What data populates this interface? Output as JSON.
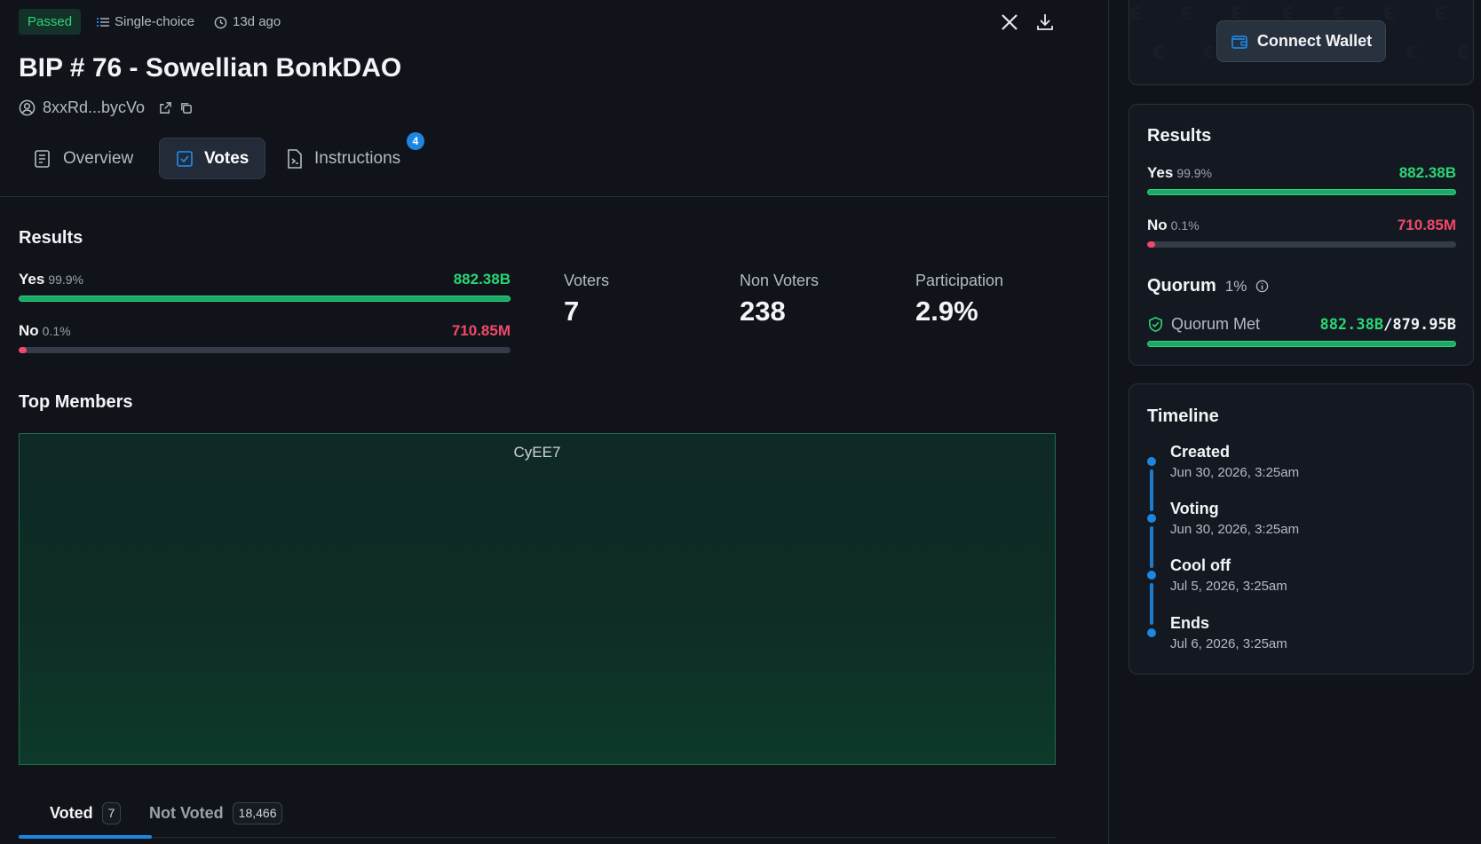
{
  "header": {
    "status": "Passed",
    "vote_type": "Single-choice",
    "time_ago": "13d ago",
    "title": "BIP # 76 - Sowellian BonkDAO",
    "author": "8xxRd...bycVo"
  },
  "tabs": [
    {
      "label": "Overview",
      "icon": "document-list-icon"
    },
    {
      "label": "Votes",
      "icon": "checkbox-icon",
      "active": true
    },
    {
      "label": "Instructions",
      "icon": "code-file-icon",
      "badge": "4"
    }
  ],
  "results": {
    "heading": "Results",
    "yes": {
      "label": "Yes",
      "pct": "99.9%",
      "value": "882.38B",
      "fill": 1.0
    },
    "no": {
      "label": "No",
      "pct": "0.1%",
      "value": "710.85M",
      "fill": 0.001
    }
  },
  "stats": {
    "voters_label": "Voters",
    "voters": "7",
    "non_voters_label": "Non Voters",
    "non_voters": "238",
    "participation_label": "Participation",
    "participation": "2.9%"
  },
  "top_members": {
    "heading": "Top Members",
    "member": "CyEE7"
  },
  "bottom_tabs": {
    "voted_label": "Voted",
    "voted_count": "7",
    "not_voted_label": "Not Voted",
    "not_voted_count": "18,466"
  },
  "sidebar": {
    "wallet_label": "Connect Wallet",
    "results": {
      "heading": "Results",
      "yes_label": "Yes",
      "yes_pct": "99.9%",
      "yes_value": "882.38B",
      "no_label": "No",
      "no_pct": "0.1%",
      "no_value": "710.85M",
      "quorum_label": "Quorum",
      "quorum_pct": "1%",
      "quorum_met_label": "Quorum Met",
      "quorum_current": "882.38B",
      "quorum_required": "/879.95B",
      "quorum_fill": 1.0
    },
    "timeline": {
      "heading": "Timeline",
      "items": [
        {
          "title": "Created",
          "date": "Jun 30, 2026, 3:25am"
        },
        {
          "title": "Voting",
          "date": "Jun 30, 2026, 3:25am"
        },
        {
          "title": "Cool off",
          "date": "Jul 5, 2026, 3:25am"
        },
        {
          "title": "Ends",
          "date": "Jul 6, 2026, 3:25am"
        }
      ]
    }
  },
  "colors": {
    "yes": "#2bd576",
    "no": "#f2486c",
    "accent": "#1d86e0"
  }
}
